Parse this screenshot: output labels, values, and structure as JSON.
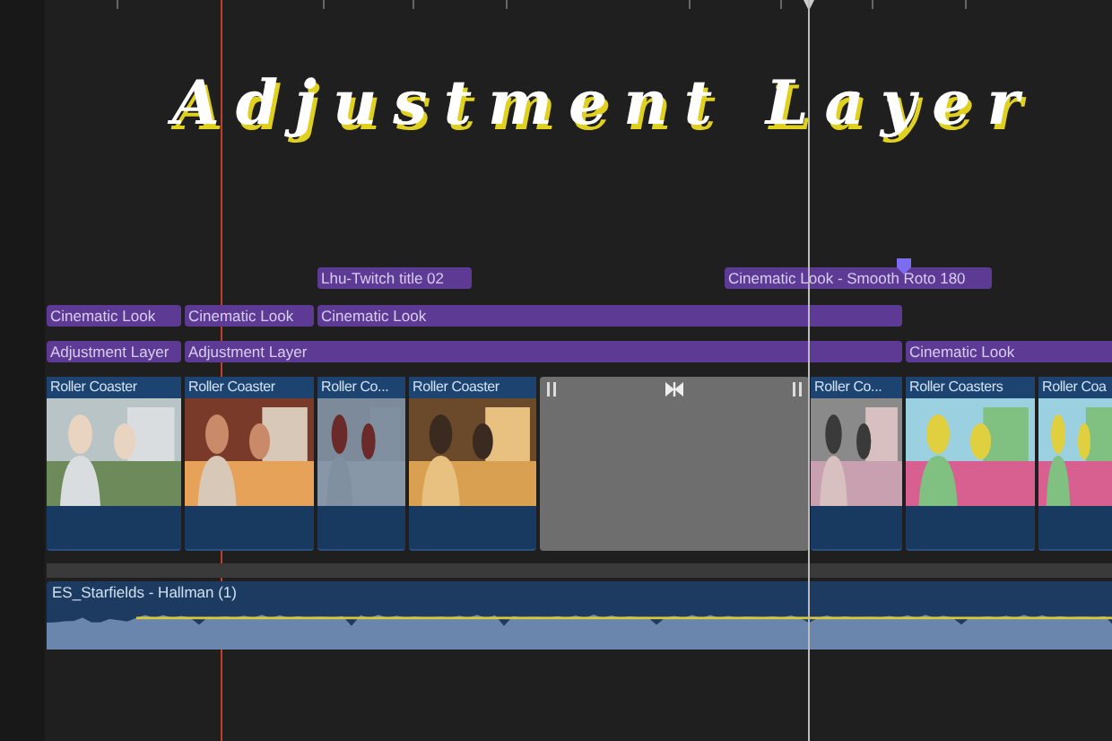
{
  "overlay_title": "Adjustment Layer",
  "title_lane": [
    {
      "label": "Lhu-Twitch title 02",
      "marker": false
    },
    {
      "label": "Cinematic Look - Smooth Roto 180",
      "marker": true
    }
  ],
  "effect_lane": [
    {
      "label": "Cinematic Look"
    },
    {
      "label": "Cinematic Look"
    },
    {
      "label": "Cinematic Look"
    }
  ],
  "adjustment_lane": [
    {
      "label": "Adjustment Layer"
    },
    {
      "label": "Adjustment Layer"
    },
    {
      "label": "Cinematic Look"
    }
  ],
  "clips": [
    {
      "kind": "clip",
      "label": "Roller Coaster"
    },
    {
      "kind": "clip",
      "label": "Roller Coaster"
    },
    {
      "kind": "clip",
      "label": "Roller Co..."
    },
    {
      "kind": "clip",
      "label": "Roller Coaster"
    },
    {
      "kind": "gap"
    },
    {
      "kind": "clip",
      "label": "Roller Co..."
    },
    {
      "kind": "clip",
      "label": "Roller Coasters"
    },
    {
      "kind": "clip",
      "label": "Roller Coa"
    }
  ],
  "audio": {
    "label": "ES_Starfields - Hallman (1)"
  }
}
